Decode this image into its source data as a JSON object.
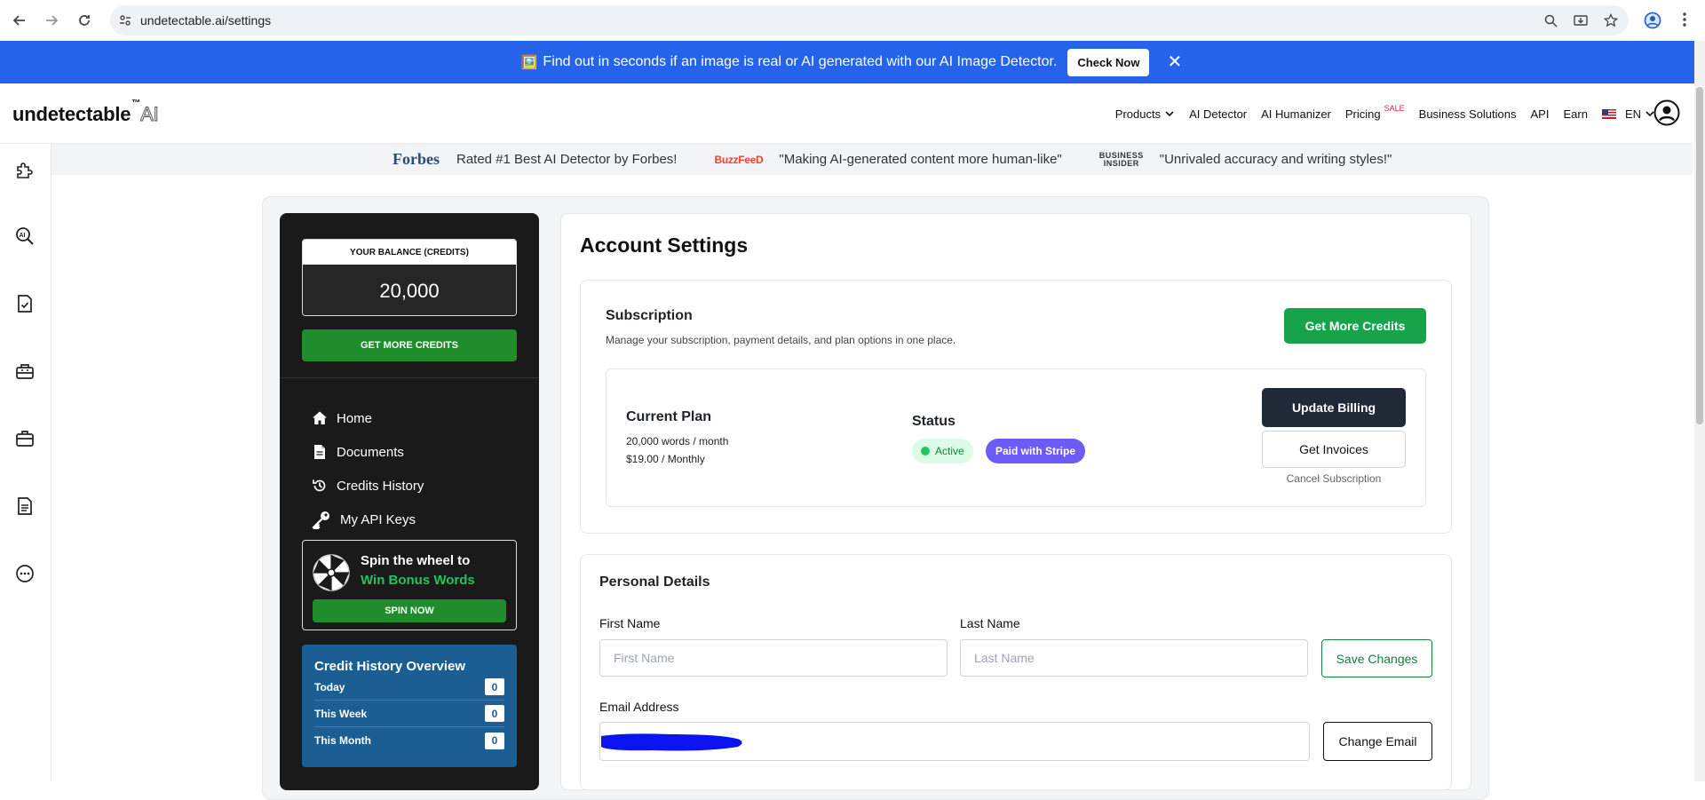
{
  "browser": {
    "url": "undetectable.ai/settings"
  },
  "banner": {
    "emoji": "🖼️",
    "text": "Find out in seconds if an image is real or AI generated with our AI Image Detector.",
    "button": "Check Now",
    "close": "✕"
  },
  "header": {
    "logo_main": "undetectable",
    "logo_tm": "™",
    "logo_ai": "AI",
    "nav": {
      "products": "Products",
      "detector": "AI Detector",
      "humanizer": "AI Humanizer",
      "pricing": "Pricing",
      "sale": "SALE",
      "business": "Business Solutions",
      "api": "API",
      "earn": "Earn",
      "lang": "EN"
    }
  },
  "press": {
    "forbes": "Forbes",
    "forbes_quote": "Rated #1 Best AI Detector by Forbes!",
    "buzzfeed": "BuzzFeeD",
    "buzzfeed_quote": "\"Making AI-generated content more human-like\"",
    "bi_line1": "BUSINESS",
    "bi_line2": "INSIDER",
    "bi_quote": "\"Unrivaled accuracy and writing styles!\""
  },
  "sidebar": {
    "balance_label": "YOUR BALANCE (CREDITS)",
    "balance_value": "20,000",
    "get_credits": "GET MORE CREDITS",
    "menu": [
      {
        "label": "Home",
        "icon": "home-icon"
      },
      {
        "label": "Documents",
        "icon": "document-icon"
      },
      {
        "label": "Credits History",
        "icon": "history-icon"
      },
      {
        "label": "My API Keys",
        "icon": "key-icon"
      }
    ],
    "spin": {
      "line1": "Spin the wheel to",
      "line2": "Win Bonus Words",
      "button": "SPIN NOW"
    },
    "credit_overview": {
      "title": "Credit History Overview",
      "rows": [
        {
          "label": "Today",
          "value": "0"
        },
        {
          "label": "This Week",
          "value": "0"
        },
        {
          "label": "This Month",
          "value": "0"
        }
      ]
    }
  },
  "account": {
    "title": "Account Settings",
    "subscription": {
      "title": "Subscription",
      "desc": "Manage your subscription, payment details, and plan options in one place.",
      "get_more": "Get More Credits",
      "plan_title": "Current Plan",
      "plan_words": "20,000 words / month",
      "plan_price": "$19.00 / Monthly",
      "status_title": "Status",
      "status_active": "Active",
      "status_payment": "Paid with Stripe",
      "update_billing": "Update Billing",
      "get_invoices": "Get Invoices",
      "cancel": "Cancel Subscription"
    },
    "personal": {
      "title": "Personal Details",
      "first_label": "First Name",
      "first_placeholder": "First Name",
      "last_label": "Last Name",
      "last_placeholder": "Last Name",
      "save": "Save Changes",
      "email_label": "Email Address",
      "change_email": "Change Email"
    }
  },
  "colors": {
    "banner": "#2563eb",
    "green": "#16a34a",
    "dark": "#1f2937",
    "stripe": "#6d5bf5",
    "overview": "#1b5e94"
  }
}
